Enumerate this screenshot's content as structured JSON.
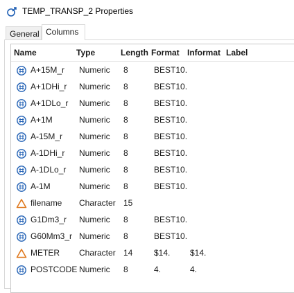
{
  "window": {
    "title": "TEMP_TRANSP_2 Properties",
    "icon": "table-properties-icon"
  },
  "tabs": [
    {
      "label": "General",
      "active": false
    },
    {
      "label": "Columns",
      "active": true
    }
  ],
  "columns_table": {
    "headers": {
      "name": "Name",
      "type": "Type",
      "length": "Length",
      "format": "Format",
      "informat": "Informat",
      "label": "Label"
    },
    "rows": [
      {
        "icon": "numeric-icon",
        "name": "A+15M_r",
        "type": "Numeric",
        "length": "8",
        "format": "BEST10.",
        "informat": "",
        "label": ""
      },
      {
        "icon": "numeric-icon",
        "name": "A+1DHi_r",
        "type": "Numeric",
        "length": "8",
        "format": "BEST10.",
        "informat": "",
        "label": ""
      },
      {
        "icon": "numeric-icon",
        "name": "A+1DLo_r",
        "type": "Numeric",
        "length": "8",
        "format": "BEST10.",
        "informat": "",
        "label": ""
      },
      {
        "icon": "numeric-icon",
        "name": "A+1M",
        "type": "Numeric",
        "length": "8",
        "format": "BEST10.",
        "informat": "",
        "label": ""
      },
      {
        "icon": "numeric-icon",
        "name": "A-15M_r",
        "type": "Numeric",
        "length": "8",
        "format": "BEST10.",
        "informat": "",
        "label": ""
      },
      {
        "icon": "numeric-icon",
        "name": "A-1DHi_r",
        "type": "Numeric",
        "length": "8",
        "format": "BEST10.",
        "informat": "",
        "label": ""
      },
      {
        "icon": "numeric-icon",
        "name": "A-1DLo_r",
        "type": "Numeric",
        "length": "8",
        "format": "BEST10.",
        "informat": "",
        "label": ""
      },
      {
        "icon": "numeric-icon",
        "name": "A-1M",
        "type": "Numeric",
        "length": "8",
        "format": "BEST10.",
        "informat": "",
        "label": ""
      },
      {
        "icon": "character-icon",
        "name": "filename",
        "type": "Character",
        "length": "15",
        "format": "",
        "informat": "",
        "label": ""
      },
      {
        "icon": "numeric-icon",
        "name": "G1Dm3_r",
        "type": "Numeric",
        "length": "8",
        "format": "BEST10.",
        "informat": "",
        "label": ""
      },
      {
        "icon": "numeric-icon",
        "name": "G60Mm3_r",
        "type": "Numeric",
        "length": "8",
        "format": "BEST10.",
        "informat": "",
        "label": ""
      },
      {
        "icon": "character-icon",
        "name": "METER",
        "type": "Character",
        "length": "14",
        "format": "$14.",
        "informat": "$14.",
        "label": ""
      },
      {
        "icon": "numeric-icon",
        "name": "POSTCODE",
        "type": "Numeric",
        "length": "8",
        "format": "4.",
        "informat": "4.",
        "label": ""
      }
    ]
  },
  "colors": {
    "numeric_icon": "#1f5fb4",
    "character_icon": "#e07a1f",
    "title_icon": "#1f5fb4"
  }
}
